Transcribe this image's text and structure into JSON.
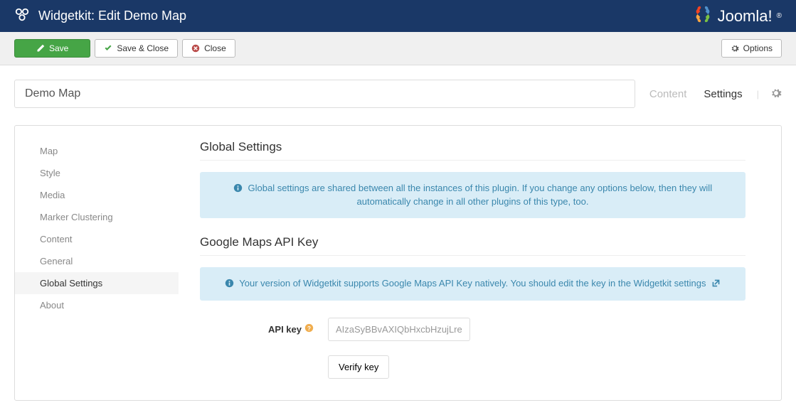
{
  "header": {
    "title": "Widgetkit: Edit Demo Map",
    "brand": "Joomla!"
  },
  "toolbar": {
    "save_label": "Save",
    "save_close_label": "Save & Close",
    "close_label": "Close",
    "options_label": "Options"
  },
  "page": {
    "title_value": "Demo Map",
    "tabs": {
      "content": "Content",
      "settings": "Settings"
    }
  },
  "sidebar": {
    "items": [
      "Map",
      "Style",
      "Media",
      "Marker Clustering",
      "Content",
      "General",
      "Global Settings",
      "About"
    ],
    "active_index": 6
  },
  "sections": {
    "global_title": "Global Settings",
    "global_alert": "Global settings are shared between all the instances of this plugin. If you change any options below, then they will automatically change in all other plugins of this type, too.",
    "api_title": "Google Maps API Key",
    "api_alert": "Your version of Widgetkit supports Google Maps API Key natively. You should edit the key in the Widgetkit settings",
    "api_label": "API key",
    "api_value": "AIzaSyBBvAXIQbHxcbHzujLreu",
    "verify_label": "Verify key"
  }
}
